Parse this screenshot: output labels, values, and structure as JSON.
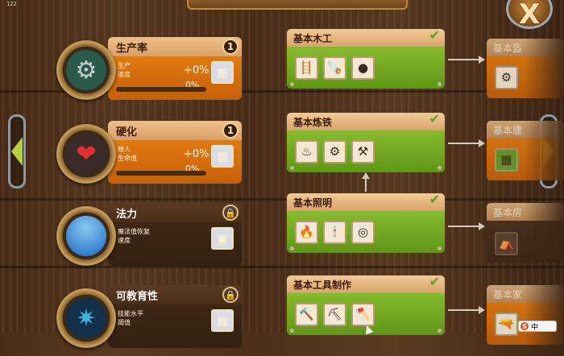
{
  "fps": "122",
  "close_icon_glyph": "X",
  "skills": [
    {
      "name": "生产率",
      "badge": "1",
      "stat1": "生产",
      "stat2": "速度",
      "bonus": "+0%",
      "progress_pct": "0%",
      "progress_value": 0,
      "icon": "gears-icon",
      "state": "orange"
    },
    {
      "name": "硬化",
      "badge": "1",
      "stat1": "矮人",
      "stat2": "生命值",
      "bonus": "+0%",
      "progress_pct": "0%",
      "progress_value": 0,
      "icon": "heart-shield-icon",
      "state": "orange"
    },
    {
      "name": "法力",
      "badge": "🔒",
      "stat1": "魔法值恢复",
      "stat2": "速度",
      "bonus": "",
      "progress_pct": "",
      "icon": "mana-orb-icon",
      "state": "dark"
    },
    {
      "name": "可教育性",
      "badge": "🔒",
      "stat1": "技能水平",
      "stat2": "阈值",
      "bonus": "",
      "progress_pct": "",
      "icon": "mind-icon",
      "state": "dark"
    }
  ],
  "techs": [
    {
      "name": "基本木工",
      "items": [
        "ladder-icon",
        "saw-icon",
        "shield-icon"
      ],
      "glyphs": [
        "🪜",
        "🪚",
        "●"
      ]
    },
    {
      "name": "基本炼铁",
      "items": [
        "cauldron-icon",
        "ore-icon",
        "anvil-icon"
      ],
      "glyphs": [
        "♨",
        "⚙",
        "⚒"
      ]
    },
    {
      "name": "基本照明",
      "items": [
        "torch-icon",
        "candle-icon",
        "plate-icon"
      ],
      "glyphs": [
        "🔥",
        "🕯",
        "◎"
      ]
    },
    {
      "name": "基本工具制作",
      "items": [
        "hammer-icon",
        "pickaxe-icon",
        "axe-icon"
      ],
      "glyphs": [
        "🔨",
        "⛏",
        "🪓"
      ]
    }
  ],
  "next_techs": [
    {
      "name": "基本盔",
      "glyph": "⚙"
    },
    {
      "name": "基本建",
      "glyph": "▦"
    },
    {
      "name": "基本房",
      "glyph": "⛺"
    },
    {
      "name": "基本家",
      "glyph": "🔫"
    }
  ],
  "ime": {
    "label": "中"
  },
  "colors": {
    "accent_green": "#86bb2c",
    "accent_orange": "#e07a10",
    "wood": "#4a2d17"
  }
}
